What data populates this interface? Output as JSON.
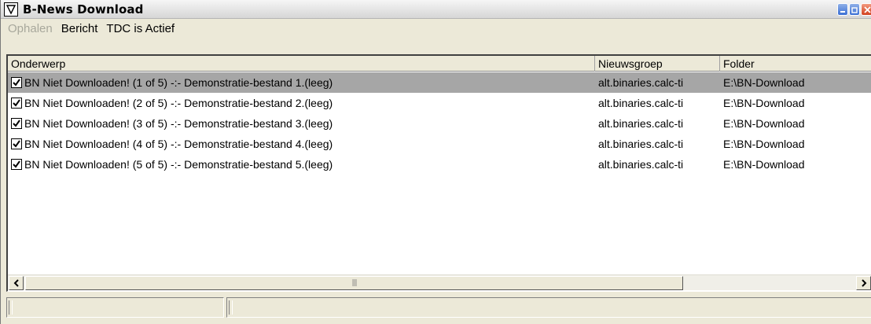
{
  "window": {
    "title": "B-News Download",
    "controls": [
      "minimize-icon",
      "maximize-icon",
      "close-icon"
    ]
  },
  "menu": [
    {
      "label": "Ophalen",
      "enabled": false
    },
    {
      "label": "Bericht",
      "enabled": true
    },
    {
      "label": "TDC is Actief",
      "enabled": true
    }
  ],
  "list": {
    "columns": [
      "Onderwerp",
      "Nieuwsgroep",
      "Folder"
    ],
    "rows": [
      {
        "checked": true,
        "selected": true,
        "subject": "BN Niet Downloaden! (1 of 5) -:- Demonstratie-bestand 1.(leeg)",
        "group": "alt.binaries.calc-ti",
        "folder": "E:\\BN-Download"
      },
      {
        "checked": true,
        "selected": false,
        "subject": "BN Niet Downloaden! (2 of 5) -:- Demonstratie-bestand 2.(leeg)",
        "group": "alt.binaries.calc-ti",
        "folder": "E:\\BN-Download"
      },
      {
        "checked": true,
        "selected": false,
        "subject": "BN Niet Downloaden! (3 of 5) -:- Demonstratie-bestand 3.(leeg)",
        "group": "alt.binaries.calc-ti",
        "folder": "E:\\BN-Download"
      },
      {
        "checked": true,
        "selected": false,
        "subject": "BN Niet Downloaden! (4 of 5) -:- Demonstratie-bestand 4.(leeg)",
        "group": "alt.binaries.calc-ti",
        "folder": "E:\\BN-Download"
      },
      {
        "checked": true,
        "selected": false,
        "subject": "BN Niet Downloaden! (5 of 5) -:- Demonstratie-bestand 5.(leeg)",
        "group": "alt.binaries.calc-ti",
        "folder": "E:\\BN-Download"
      }
    ]
  },
  "scrollbar": {
    "left_icon": "chevron-left-icon",
    "right_icon": "chevron-right-icon",
    "grip": "|||"
  },
  "colors": {
    "selected_row": "#a6a6a6",
    "window_bg": "#ece9d8",
    "close_button": "#d1411f",
    "title_buttons": "#3b6fd4"
  }
}
